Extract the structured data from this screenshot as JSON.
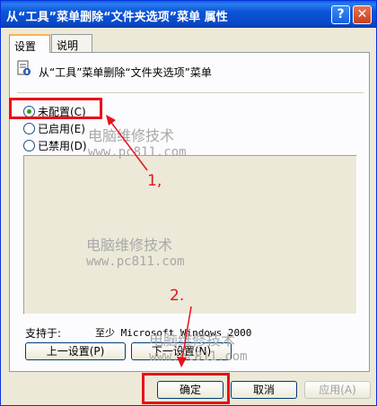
{
  "window": {
    "title": "从“工具”菜单删除“文件夹选项”菜单 属性"
  },
  "titlebar": {
    "help_label": "?",
    "close_label": "✕"
  },
  "tabs": [
    {
      "label": "设置"
    },
    {
      "label": "说明"
    }
  ],
  "policy": {
    "title": "从“工具”菜单删除“文件夹选项”菜单",
    "icon": "policy-icon"
  },
  "options": [
    {
      "label": "未配置(C)",
      "checked": true
    },
    {
      "label": "已启用(E)",
      "checked": false
    },
    {
      "label": "已禁用(D)",
      "checked": false
    }
  ],
  "support": {
    "label": "支持于:",
    "value": "至少 Microsoft Windows 2000"
  },
  "nav": {
    "prev_label": "上一设置(P)",
    "next_label": "下一设置(N)"
  },
  "dialog": {
    "ok_label": "确定",
    "cancel_label": "取消",
    "apply_label": "应用(A)"
  },
  "watermark": {
    "text": "电脑维修技术",
    "url": "www.pc811.com"
  },
  "annotations": {
    "step1": "1,",
    "step2": "2."
  },
  "colors": {
    "titlebar": "#0b55d8",
    "highlight": "#e8101a",
    "face": "#ece9d8"
  }
}
